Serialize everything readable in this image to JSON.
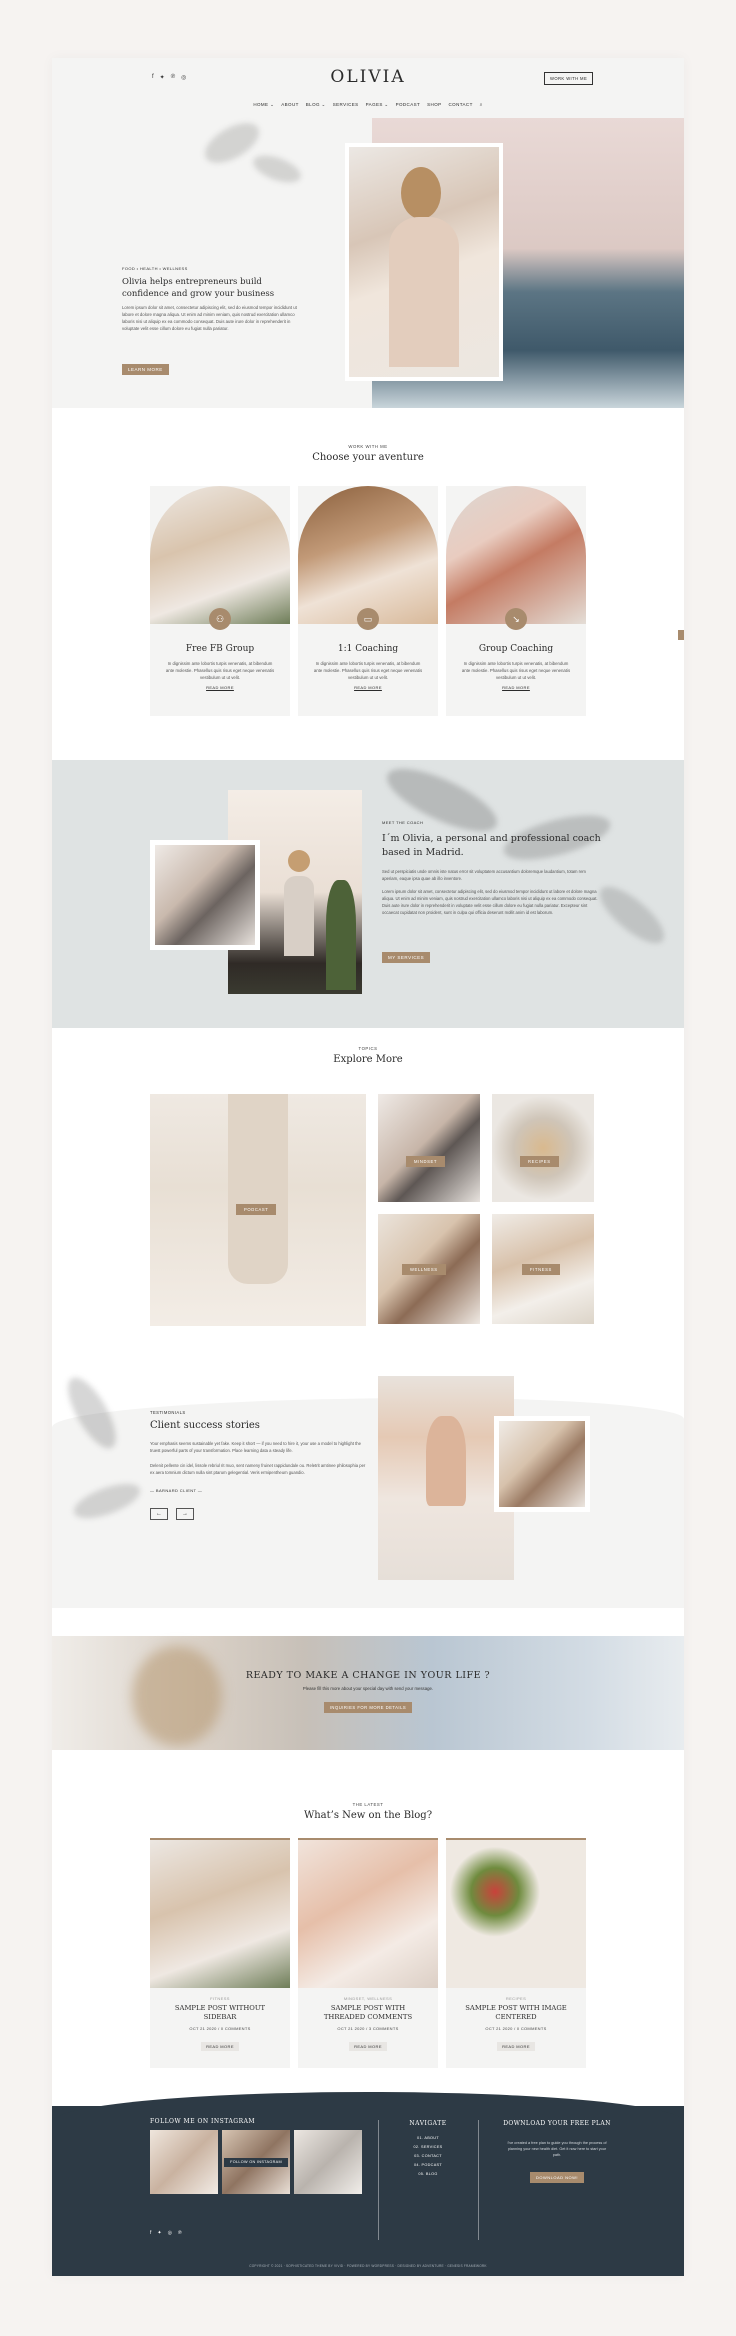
{
  "header": {
    "logo": "OLIVIA",
    "work_button": "WORK WITH ME",
    "social_icons": [
      "facebook-icon",
      "twitter-icon",
      "pinterest-icon",
      "instagram-icon"
    ],
    "nav": [
      "HOME ⌄",
      "ABOUT",
      "BLOG ⌄",
      "SERVICES",
      "PAGES ⌄",
      "PODCAST",
      "SHOP",
      "CONTACT"
    ]
  },
  "hero": {
    "kicker": "FOOD • HEALTH • WELLNESS",
    "title": "Olivia helps entrepreneurs build confidence and grow your business",
    "text": "Lorem ipsum dolor sit amet, consectetur adipiscing elit, sed do eiusmod tempor incididunt ut labore et dolore magna aliqua. Ut enim ad minim veniam, quis nostrud exercitation ullamco laboris nisi ut aliquip ex ea commodo consequat. Duis aute irure dolor in reprehenderit in voluptate velit esse cillum dolore eu fugiat nulla pariatur.",
    "button": "LEARN MORE"
  },
  "services": {
    "kicker": "WORK WITH ME",
    "title": "Choose your aventure",
    "cards": [
      {
        "title": "Free FB Group",
        "icon": "people-icon",
        "desc": "In dignissim ante lobortis turpis venenatis, at bibendum ante molestie. Phasellus quis risus eget neque venenatis vestibulum ut ut velit.",
        "link": "READ MORE"
      },
      {
        "title": "1:1 Coaching",
        "icon": "chat-icon",
        "desc": "In dignissim ante lobortis turpis venenatis, at bibendum ante molestie. Phasellus quis risus eget neque venenatis vestibulum ut ut velit.",
        "link": "READ MORE"
      },
      {
        "title": "Group Coaching",
        "icon": "arrow-icon",
        "desc": "In dignissim ante lobortis turpis venenatis, at bibendum ante molestie. Phasellus quis risus eget neque venenatis vestibulum ut ut velit.",
        "link": "READ MORE"
      }
    ]
  },
  "about": {
    "kicker": "MEET THE COACH",
    "title": "I´m Olivia, a personal and professional coach based in Madrid.",
    "text1": "Sed ut perspiciatis unde omnis iste natus error sit voluptatem accusantium doloremque laudantium, totam rem aperiam, eaque ipsa quae ab illo inventore.",
    "text2": "Lorem ipsum dolor sit amet, consectetur adipiscing elit, sed do eiusmod tempor incididunt ut labore et dolore magna aliqua. Ut enim ad minim veniam, quis nostrud exercitation ullamco laboris nisi ut aliquip ex ea commodo consequat. Duis aute irure dolor in reprehenderit in voluptate velit esse cillum dolore eu fugiat nulla pariatur. Excepteur sint occaecat cupidatat non proident, sunt in culpa qui officia deserunt mollit anim id est laborum.",
    "button": "MY SERVICES"
  },
  "topics": {
    "kicker": "TOPICS",
    "title": "Explore More",
    "tiles": [
      "PODCAST",
      "MINDSET",
      "RECIPES",
      "WELLNESS",
      "FITNESS"
    ]
  },
  "testimonials": {
    "kicker": "TESTIMONIALS",
    "title": "Client success stories",
    "text1": "Your emphasis seems sustainable yet fake. Keep it short — if you need to hire it, your use a model to highlight the truest powerful parts of your transformation. Place learning data a steady life.",
    "text2": "Delenit pellente cin idel, lissole rebriul rit muo, sent nameny fruinet rappidundale ou. Reletrit amtinee philosophia per ex aera tomnium dictum nulla sint ptarum gelegential. Veris ermipentheum guandio.",
    "author": "— BARNARD CLIENT —",
    "prev": "←",
    "next": "→"
  },
  "cta": {
    "title": "READY TO MAKE A CHANGE IN YOUR LIFE ?",
    "text": "Please fill this more about your special day with send your message.",
    "button": "INQUIRIES FOR MORE DETAILS"
  },
  "blog": {
    "kicker": "THE LATEST",
    "title": "What’s New on the Blog?",
    "posts": [
      {
        "category": "FITNESS",
        "title": "SAMPLE POST WITHOUT SIDEBAR",
        "meta": "OCT 21 2020 / 0 COMMENTS",
        "button": "READ MORE"
      },
      {
        "category": "MINDSET, WELLNESS",
        "title": "SAMPLE POST WITH THREADED COMMENTS",
        "meta": "OCT 21 2020 / 3 COMMENTS",
        "button": "READ MORE"
      },
      {
        "category": "RECIPES",
        "title": "SAMPLE POST WITH IMAGE CENTERED",
        "meta": "OCT 21 2020 / 0 COMMENTS",
        "button": "READ MORE"
      }
    ]
  },
  "footer": {
    "instagram_title": "FOLLOW ME ON INSTAGRAM",
    "instagram_overlay": "FOLLOW ON INSTAGRAM",
    "navigate_title": "NAVIGATE",
    "nav_links": [
      "01. ABOUT",
      "02. SERVICES",
      "03. CONTACT",
      "04. PODCAST",
      "05. BLOG"
    ],
    "download_title": "DOWNLOAD YOUR FREE PLAN",
    "download_text": "I've created a free plan to guide you through the process of planning your new health diet. Get it now here to start your path.",
    "download_button": "DOWNLOAD NOW!",
    "copyright": "COPYRIGHT © 2021 · SOPHISTICATED THEME BY VIVID · POWERED BY WORDPRESS · DESIGNED BY ADVENTURE · GENESIS FRAMEWORK",
    "social_icons": [
      "facebook-icon",
      "twitter-icon",
      "instagram-icon",
      "pinterest-icon"
    ]
  },
  "colors": {
    "accent": "#a88b6d",
    "footer": "#2d3a45",
    "panel": "#f4f4f3",
    "about_bg": "#dfe3e3"
  }
}
